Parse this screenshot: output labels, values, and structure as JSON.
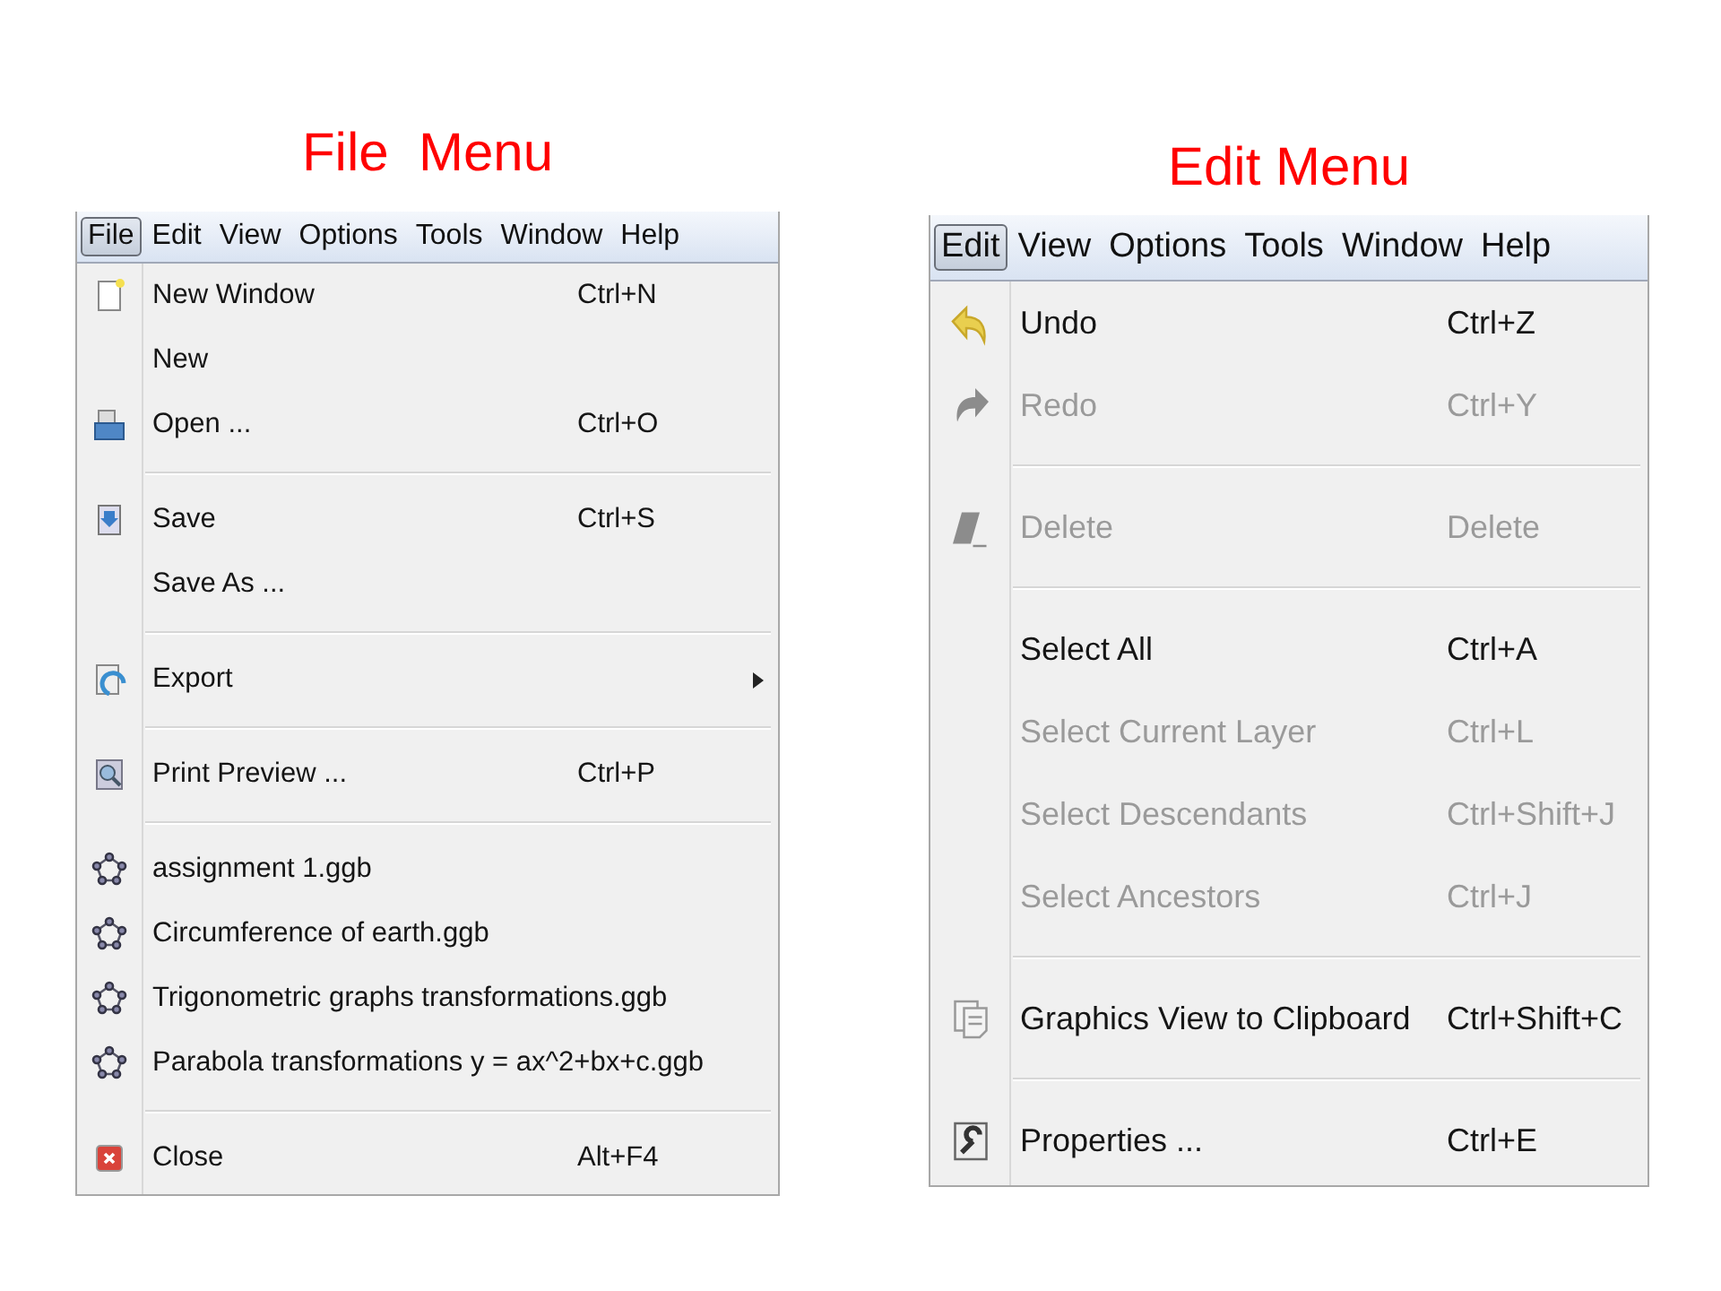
{
  "panels": [
    {
      "title": "File  Menu",
      "menubar": [
        {
          "label": "File",
          "selected": true
        },
        {
          "label": "Edit",
          "selected": false
        },
        {
          "label": "View",
          "selected": false
        },
        {
          "label": "Options",
          "selected": false
        },
        {
          "label": "Tools",
          "selected": false
        },
        {
          "label": "Window",
          "selected": false
        },
        {
          "label": "Help",
          "selected": false
        }
      ],
      "items": [
        {
          "kind": "item",
          "label": "New Window",
          "shortcut": "Ctrl+N",
          "disabled": false
        },
        {
          "kind": "item",
          "label": "New",
          "disabled": false
        },
        {
          "kind": "item",
          "label": "Open ...",
          "shortcut": "Ctrl+O",
          "disabled": false
        },
        {
          "kind": "separator"
        },
        {
          "kind": "item",
          "label": "Save",
          "shortcut": "Ctrl+S",
          "disabled": false
        },
        {
          "kind": "item",
          "label": "Save As ...",
          "disabled": false
        },
        {
          "kind": "separator"
        },
        {
          "kind": "submenu",
          "label": "Export",
          "disabled": false
        },
        {
          "kind": "separator"
        },
        {
          "kind": "item",
          "label": "Print Preview ...",
          "shortcut": "Ctrl+P",
          "disabled": false
        },
        {
          "kind": "separator"
        },
        {
          "kind": "item",
          "label": "assignment 1.ggb",
          "disabled": false
        },
        {
          "kind": "item",
          "label": "Circumference of earth.ggb",
          "disabled": false
        },
        {
          "kind": "item",
          "label": "Trigonometric graphs transformations.ggb",
          "disabled": false
        },
        {
          "kind": "item",
          "label": "Parabola transformations y = ax^2+bx+c.ggb",
          "disabled": false
        },
        {
          "kind": "separator"
        },
        {
          "kind": "item",
          "label": "Close",
          "shortcut": "Alt+F4",
          "disabled": false
        }
      ]
    },
    {
      "title": "Edit Menu",
      "menubar": [
        {
          "label": "Edit",
          "selected": true
        },
        {
          "label": "View",
          "selected": false
        },
        {
          "label": "Options",
          "selected": false
        },
        {
          "label": "Tools",
          "selected": false
        },
        {
          "label": "Window",
          "selected": false
        },
        {
          "label": "Help",
          "selected": false
        }
      ],
      "items": [
        {
          "kind": "item",
          "label": "Undo",
          "shortcut": "Ctrl+Z",
          "disabled": false
        },
        {
          "kind": "item",
          "label": "Redo",
          "shortcut": "Ctrl+Y",
          "disabled": true
        },
        {
          "kind": "separator"
        },
        {
          "kind": "item",
          "label": "Delete",
          "shortcut": "Delete",
          "disabled": true
        },
        {
          "kind": "separator"
        },
        {
          "kind": "item",
          "label": "Select All",
          "shortcut": "Ctrl+A",
          "disabled": false
        },
        {
          "kind": "item",
          "label": "Select Current Layer",
          "shortcut": "Ctrl+L",
          "disabled": true
        },
        {
          "kind": "item",
          "label": "Select Descendants",
          "shortcut": "Ctrl+Shift+J",
          "disabled": true
        },
        {
          "kind": "item",
          "label": "Select Ancestors",
          "shortcut": "Ctrl+J",
          "disabled": true
        },
        {
          "kind": "separator"
        },
        {
          "kind": "item",
          "label": "Graphics View to Clipboard",
          "shortcut": "Ctrl+Shift+C",
          "disabled": false
        },
        {
          "kind": "separator"
        },
        {
          "kind": "item",
          "label": "Properties ...",
          "shortcut": "Ctrl+E",
          "disabled": false
        }
      ]
    }
  ]
}
